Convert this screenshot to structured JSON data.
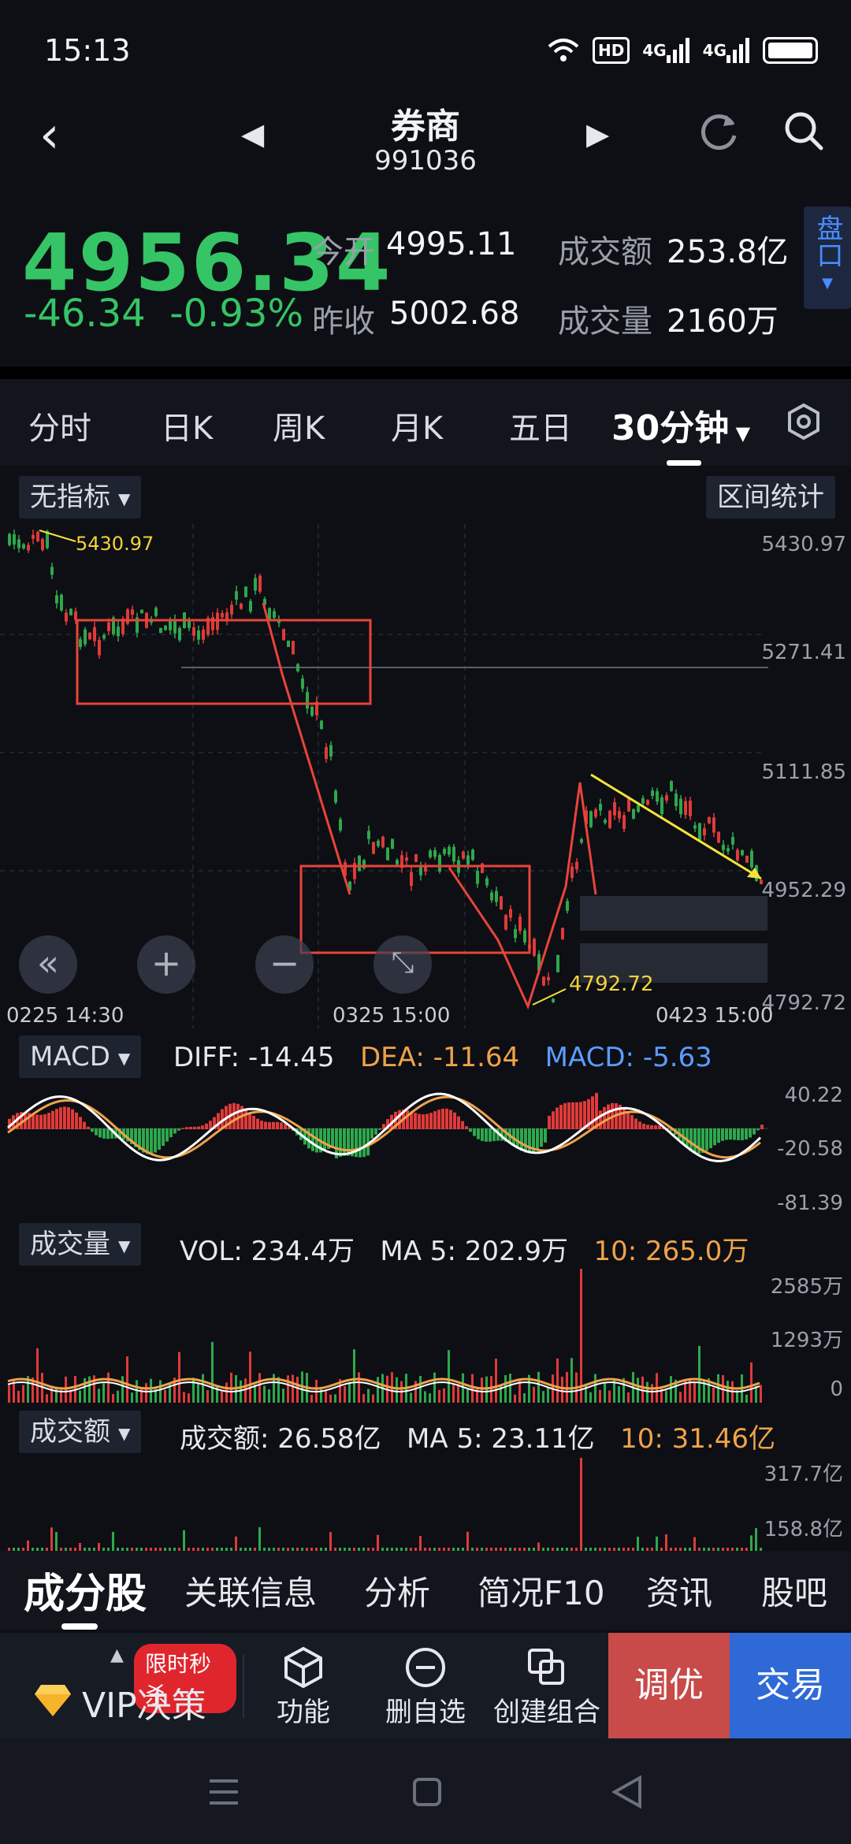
{
  "status_bar": {
    "time": "15:13",
    "hd": "HD",
    "net1": "4G",
    "net2": "4G"
  },
  "nav": {
    "title": "券商",
    "code": "991036"
  },
  "quote": {
    "price": "4956.34",
    "change": "-46.34",
    "change_pct": "-0.93%",
    "open_label": "今开",
    "open_value": "4995.11",
    "prev_close_label": "昨收",
    "prev_close_value": "5002.68",
    "turnover_label": "成交额",
    "turnover_value": "253.8亿",
    "volume_label": "成交量",
    "volume_value": "2160万",
    "pankou": "盘口"
  },
  "period_tabs": [
    "分时",
    "日K",
    "周K",
    "月K",
    "五日",
    "30分钟"
  ],
  "chart": {
    "indicator_chip": "无指标",
    "range_stats": "区间统计",
    "price_axis": [
      "5430.97",
      "5271.41",
      "5111.85",
      "4952.29",
      "4792.72"
    ],
    "date_axis": [
      "0225  14:30",
      "0325  15:00",
      "0423  15:00"
    ],
    "high_label": "5430.97",
    "low_label": "4792.72",
    "colors": {
      "up": "#e03a3a",
      "down": "#2ea84c",
      "annot_red": "#e8443a",
      "annot_yellow": "#f4e23a"
    }
  },
  "macd": {
    "chip": "MACD",
    "diff": "DIFF: -14.45",
    "dea": "DEA: -11.64",
    "macd": "MACD: -5.63",
    "axis": [
      "40.22",
      "-20.58",
      "-81.39"
    ]
  },
  "volume": {
    "chip": "成交量",
    "vol": "VOL: 234.4万",
    "ma5": "MA 5: 202.9万",
    "ma10": "10: 265.0万",
    "axis": [
      "2585万",
      "1293万",
      "0"
    ]
  },
  "turnover": {
    "chip": "成交额",
    "amount": "成交额: 26.58亿",
    "ma5": "MA 5: 23.11亿",
    "ma10": "10: 31.46亿",
    "axis": [
      "317.7亿",
      "158.8亿"
    ]
  },
  "bottom_tabs": [
    "成分股",
    "关联信息",
    "分析",
    "简况F10",
    "资讯",
    "股吧"
  ],
  "actions": {
    "vip": "VIP决策",
    "vip_badge": "限时秒杀",
    "func": "功能",
    "remove": "删自选",
    "combo": "创建组合",
    "tune": "调优",
    "trade": "交易"
  }
}
